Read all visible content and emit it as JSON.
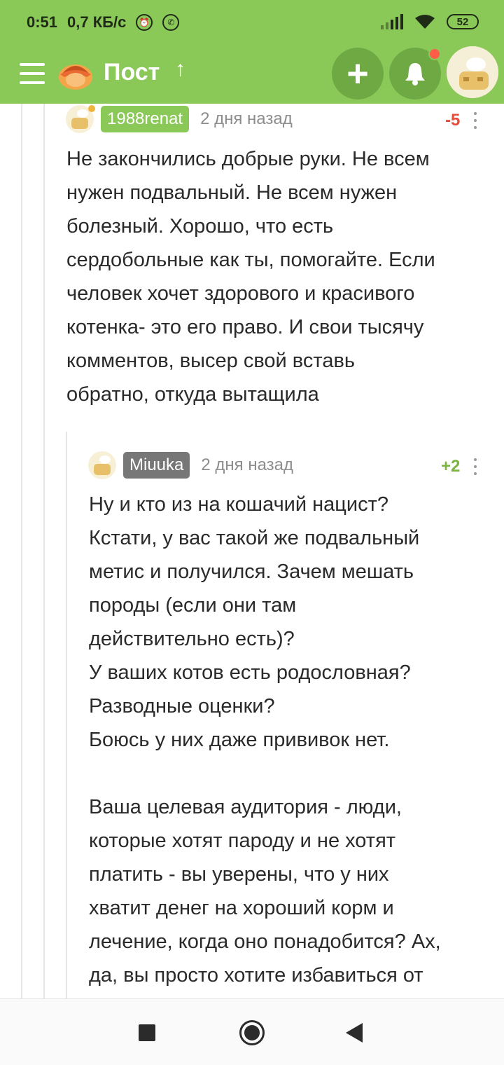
{
  "status_bar": {
    "time": "0:51",
    "speed": "0,7 КБ/с",
    "battery": "52",
    "icons": [
      "alarm-icon",
      "viber-icon",
      "signal-icon",
      "wifi-icon",
      "battery-icon"
    ]
  },
  "header": {
    "title": "Пост",
    "up_arrow": "↑",
    "add_label": "+",
    "accent_color": "#8ac858",
    "notification_color": "#ff5c4a"
  },
  "comments": [
    {
      "username": "1988renat",
      "username_color": "#8ac858",
      "time": "2 дня назад",
      "rating": "-5",
      "rating_color": "#e74c3c",
      "text": "Не закончились добрые руки. Не всем\nнужен подвальный. Не всем нужен\nболезный. Хорошо, что есть\nсердобольные как ты, помогайте. Если\nчеловек хочет здорового и красивого\nкотенка- это его право. И свои тысячу\nкомментов, высер свой вставь\nобратно, откуда вытащила"
    },
    {
      "username": "Miuuka",
      "username_color": "#777777",
      "time": "2 дня назад",
      "rating": "+2",
      "rating_color": "#7cb342",
      "text": "Ну и кто из на кошачий нацист?\nКстати, у вас такой же подвальный\nметис и получился. Зачем мешать\nпороды (если они там\nдействительно есть)?\nУ ваших котов есть родословная?\nРазводные оценки?\nБоюсь у них даже прививок нет.\n\nВаша целевая аудитория - люди,\nкоторые хотят пароду и не хотят\nплатить - вы уверены, что у них\nхватит денег на хороший корм и\nлечение, когда оно понадобится? Ах,\nда, вы просто хотите избавиться от"
    }
  ],
  "nav_bar": {
    "icons": [
      "recents-square-icon",
      "home-circle-icon",
      "back-triangle-icon"
    ]
  }
}
